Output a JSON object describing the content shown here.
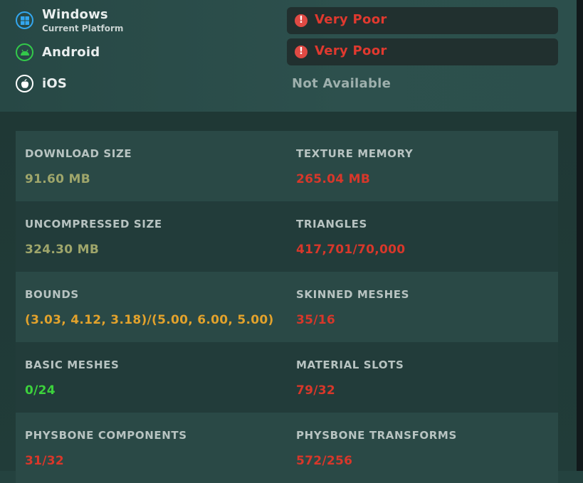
{
  "platforms": [
    {
      "name": "Windows",
      "subtitle": "Current Platform",
      "icon": "windows-icon",
      "status": "Very Poor",
      "status_type": "rating",
      "icon_color": "#33a6ee"
    },
    {
      "name": "Android",
      "subtitle": "",
      "icon": "android-icon",
      "status": "Very Poor",
      "status_type": "rating",
      "icon_color": "#33c94a"
    },
    {
      "name": "iOS",
      "subtitle": "",
      "icon": "apple-icon",
      "status": "Not Available",
      "status_type": "plain",
      "icon_color": "#ffffff"
    }
  ],
  "stats": [
    {
      "left": {
        "label": "DOWNLOAD SIZE",
        "value": "91.60 MB",
        "color": "#9fa66b"
      },
      "right": {
        "label": "TEXTURE MEMORY",
        "value": "265.04 MB",
        "color": "#d8372a"
      }
    },
    {
      "left": {
        "label": "UNCOMPRESSED SIZE",
        "value": "324.30 MB",
        "color": "#9fa66b"
      },
      "right": {
        "label": "TRIANGLES",
        "value": "417,701/70,000",
        "color": "#d8372a"
      }
    },
    {
      "left": {
        "label": "BOUNDS",
        "value": "(3.03, 4.12, 3.18)/(5.00, 6.00, 5.00)",
        "color": "#e2a22c"
      },
      "right": {
        "label": "SKINNED MESHES",
        "value": "35/16",
        "color": "#d8372a"
      }
    },
    {
      "left": {
        "label": "BASIC MESHES",
        "value": "0/24",
        "color": "#3cd23c"
      },
      "right": {
        "label": "MATERIAL SLOTS",
        "value": "79/32",
        "color": "#d8372a"
      }
    },
    {
      "left": {
        "label": "PHYSBONE COMPONENTS",
        "value": "31/32",
        "color": "#d8372a"
      },
      "right": {
        "label": "PHYSBONE TRANSFORMS",
        "value": "572/256",
        "color": "#d8372a"
      }
    }
  ]
}
